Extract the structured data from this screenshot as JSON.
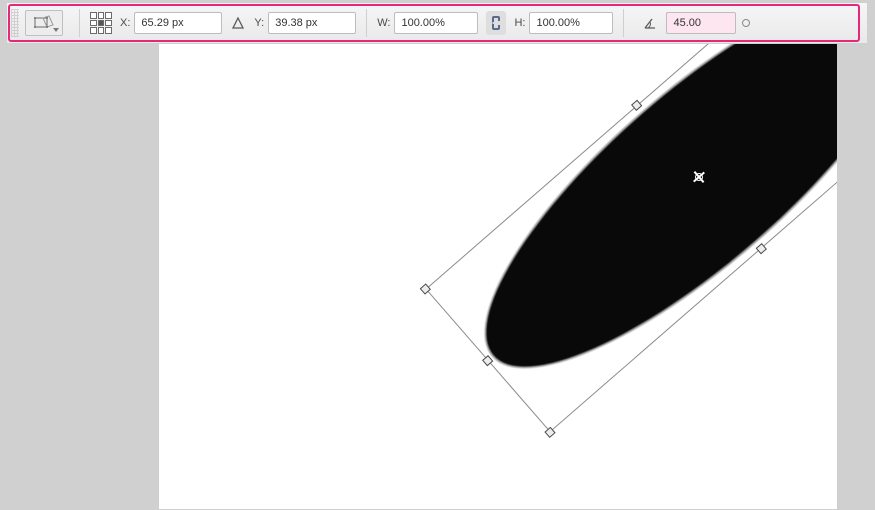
{
  "options_bar": {
    "x_label": "X:",
    "x_value": "65.29 px",
    "y_label": "Y:",
    "y_value": "39.38 px",
    "w_label": "W:",
    "w_value": "100.00%",
    "h_label": "H:",
    "h_value": "100.00%",
    "rotate_value": "45.00",
    "reference_point_selected": "center",
    "aspect_linked": true
  },
  "icons": {
    "tool": "transform-tool",
    "relative_delta": "relative-position-icon",
    "link": "link-icon",
    "angle": "angle-icon",
    "reference": "reference-point-icon"
  },
  "canvas": {
    "rotation_visual_deg": -41,
    "shape": "ellipse",
    "fill": "#090909"
  }
}
